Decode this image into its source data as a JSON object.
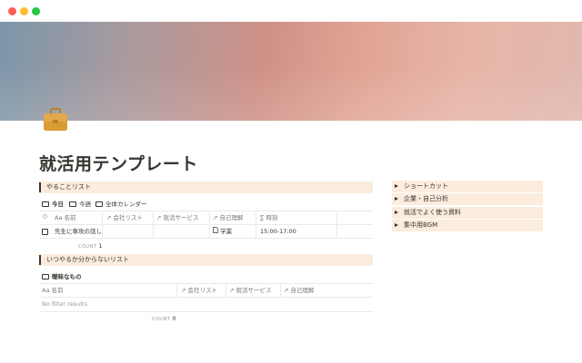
{
  "page": {
    "title": "就活用テンプレート",
    "icon": "briefcase-icon",
    "icon_color": "#d99c34"
  },
  "todo": {
    "heading": "やることリスト",
    "tabs": [
      {
        "label": "今日",
        "icon": "table-icon",
        "active": true
      },
      {
        "label": "今週",
        "icon": "calendar-icon",
        "active": false
      },
      {
        "label": "全体カレンダー",
        "icon": "calendar-icon",
        "active": false
      }
    ],
    "columns": {
      "status_icon": "sun-icon",
      "name": "名前",
      "name_prefix": "Aa",
      "company": "会社リスト",
      "job_service": "就活サービス",
      "self": "自己理解",
      "time": "時刻",
      "time_prefix": "∑"
    },
    "rows": [
      {
        "name": "先生に専攻の話し",
        "company": "",
        "job_service": "",
        "self": "学業",
        "time": "15:00-17:00"
      }
    ],
    "count_label": "COUNT",
    "count_value": "1"
  },
  "unknown": {
    "heading": "いつやるか分からないリスト",
    "tabs": [
      {
        "label": "曖昧なもの",
        "icon": "table-icon",
        "active": true
      }
    ],
    "columns": {
      "name": "名前",
      "name_prefix": "Aa",
      "company": "会社リスト",
      "job_service": "就活サービス",
      "self": "自己理解"
    },
    "empty_text": "No filter results.",
    "count_label": "COUNT",
    "count_value": "0"
  },
  "sidebar": {
    "toggles": [
      {
        "label": "ショートカット"
      },
      {
        "label": "企業・自己分析"
      },
      {
        "label": "就活でよく使う資料"
      },
      {
        "label": "集中用BGM"
      }
    ],
    "bg_color": "#fbecdd"
  },
  "colors": {
    "accent": "#fbecdd",
    "text": "#37352f",
    "muted": "#9b9a97"
  }
}
